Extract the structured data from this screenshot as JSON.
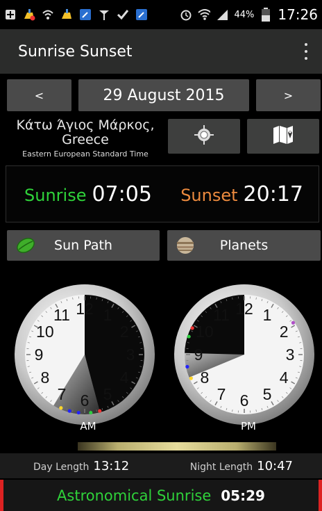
{
  "status_bar": {
    "battery": "44%",
    "time": "17:26",
    "icons": [
      "plus-icon",
      "cleaner-warning-icon",
      "wifi-signal-icon",
      "cleaner-icon",
      "tool-icon",
      "antenna-icon",
      "check-icon",
      "tool-icon",
      "alarm-icon",
      "wifi-icon",
      "cell-signal-icon",
      "battery-icon"
    ]
  },
  "app_bar": {
    "title": "Sunrise Sunset",
    "menu_icon": "more-vert-icon"
  },
  "date_nav": {
    "prev_label": "<",
    "date": "29 August 2015",
    "next_label": ">"
  },
  "location": {
    "name": "Κάτω Άγιος Μάρκος,",
    "country": "Greece",
    "timezone": "Eastern European Standard Time",
    "locate_icon": "crosshair-icon",
    "map_icon": "map-icon"
  },
  "sun_times": {
    "sunrise_label": "Sunrise",
    "sunrise_time": "07:05",
    "sunset_label": "Sunset",
    "sunset_time": "20:17"
  },
  "buttons": {
    "sun_path": "Sun Path",
    "planets": "Planets"
  },
  "clocks": {
    "am_label": "AM",
    "pm_label": "PM",
    "numerals": [
      "12",
      "1",
      "2",
      "3",
      "4",
      "5",
      "6",
      "7",
      "8",
      "9",
      "10",
      "11"
    ]
  },
  "day_info": {
    "day_length_label": "Day Length",
    "day_length": "13:12",
    "night_length_label": "Night Length",
    "night_length": "10:47"
  },
  "event": {
    "label": "Astronomical Sunrise",
    "time": "05:29"
  },
  "colors": {
    "sunrise": "#2fd23a",
    "sunset": "#ec8a3e",
    "accent_red": "#dd2222"
  }
}
